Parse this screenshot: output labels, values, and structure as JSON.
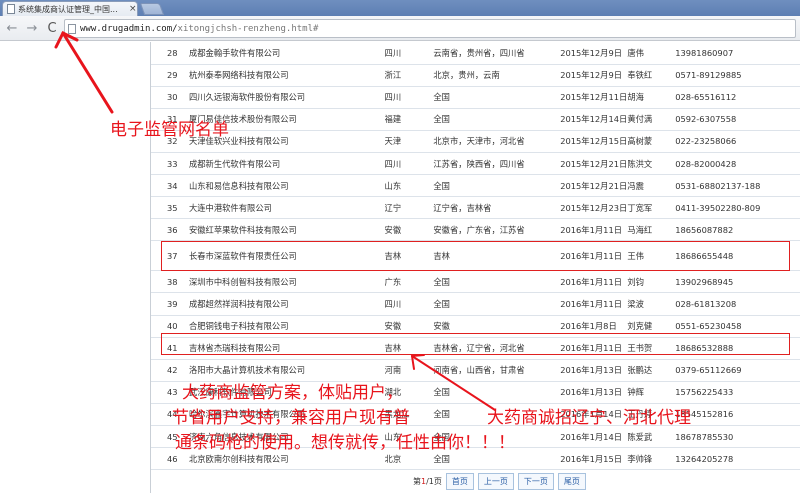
{
  "browser": {
    "tab_title": "系统集成商认证管理_中国...",
    "tab_close": "×",
    "back_glyph": "←",
    "forward_glyph": "→",
    "reload_glyph": "C",
    "url_prefix": "www.drugadmin.com/",
    "url_path": "xitongjchsh-renzheng.html#"
  },
  "table": {
    "rows": [
      {
        "no": "28",
        "name": "成都金翰手软件有限公司",
        "province": "四川",
        "area": "云南省，贵州省，四川省",
        "date": "2015年12月9日",
        "person": "唐伟",
        "phone": "13981860907"
      },
      {
        "no": "29",
        "name": "杭州泰奉网络科技有限公司",
        "province": "浙江",
        "area": "北京，贵州，云南",
        "date": "2015年12月9日",
        "person": "奉铁红",
        "phone": "0571-89129885"
      },
      {
        "no": "30",
        "name": "四川久远银海软件股份有限公司",
        "province": "四川",
        "area": "全国",
        "date": "2015年12月11日",
        "person": "胡海",
        "phone": "028-65516112"
      },
      {
        "no": "31",
        "name": "厦门易佳信技术股份有限公司",
        "province": "福建",
        "area": "全国",
        "date": "2015年12月14日",
        "person": "黄付满",
        "phone": "0592-6307558"
      },
      {
        "no": "32",
        "name": "天津佳软兴业科技有限公司",
        "province": "天津",
        "area": "北京市，天津市，河北省",
        "date": "2015年12月15日",
        "person": "高树蒙",
        "phone": "022-23258066"
      },
      {
        "no": "33",
        "name": "成都新生代软件有限公司",
        "province": "四川",
        "area": "江苏省，陕西省，四川省",
        "date": "2015年12月21日",
        "person": "陈洪文",
        "phone": "028-82000428"
      },
      {
        "no": "34",
        "name": "山东和易信息科技有限公司",
        "province": "山东",
        "area": "全国",
        "date": "2015年12月21日",
        "person": "冯震",
        "phone": "0531-68802137-188"
      },
      {
        "no": "35",
        "name": "大连中港软件有限公司",
        "province": "辽宁",
        "area": "辽宁省，吉林省",
        "date": "2015年12月23日",
        "person": "丁宽军",
        "phone": "0411-39502280-809"
      },
      {
        "no": "36",
        "name": "安徽红苹果软件科技有限公司",
        "province": "安徽",
        "area": "安徽省，广东省，江苏省",
        "date": "2016年1月11日",
        "person": "马海红",
        "phone": "18656087882"
      },
      {
        "no": "37",
        "name": "长春市深蓝软件有限责任公司",
        "province": "吉林",
        "area": "吉林",
        "date": "2016年1月11日",
        "person": "王伟",
        "phone": "18686655448"
      },
      {
        "no": "38",
        "name": "深圳市中科创智科技有限公司",
        "province": "广东",
        "area": "全国",
        "date": "2016年1月11日",
        "person": "刘钧",
        "phone": "13902968945"
      },
      {
        "no": "39",
        "name": "成都超然祥润科技有限公司",
        "province": "四川",
        "area": "全国",
        "date": "2016年1月11日",
        "person": "梁波",
        "phone": "028-61813208"
      },
      {
        "no": "40",
        "name": "合肥铜钱电子科技有限公司",
        "province": "安徽",
        "area": "安徽",
        "date": "2016年1月8日",
        "person": "刘克健",
        "phone": "0551-65230458"
      },
      {
        "no": "41",
        "name": "吉林省杰瑞科技有限公司",
        "province": "吉林",
        "area": "吉林省，辽宁省，河北省",
        "date": "2016年1月11日",
        "person": "王书贺",
        "phone": "18686532888"
      },
      {
        "no": "42",
        "name": "洛阳市大晶计算机技术有限公司",
        "province": "河南",
        "area": "河南省，山西省，甘肃省",
        "date": "2016年1月13日",
        "person": "张鹏达",
        "phone": "0379-65112669"
      },
      {
        "no": "43",
        "name": "武汉康科软件有限公司",
        "province": "湖北",
        "area": "全国",
        "date": "2016年1月13日",
        "person": "钟辉",
        "phone": "15756225433"
      },
      {
        "no": "44",
        "name": "哈尔滨鑫字计算机技术有限公司",
        "province": "黑龙江",
        "area": "全国",
        "date": "2016年1月14日",
        "person": "王丹婷",
        "phone": "18545152816"
      },
      {
        "no": "45",
        "name": "济南六角信息技术有限公司",
        "province": "山东",
        "area": "全国",
        "date": "2016年1月14日",
        "person": "陈爱武",
        "phone": "18678785530"
      },
      {
        "no": "46",
        "name": "北京欧南尔创科技有限公司",
        "province": "北京",
        "area": "全国",
        "date": "2016年1月15日",
        "person": "李帅锋",
        "phone": "13264205278"
      }
    ]
  },
  "pager": {
    "prefix": "第",
    "current": "1",
    "middle": "/1",
    "suffix": "页",
    "first": "首页",
    "prev": "上一页",
    "next": "下一页",
    "last": "尾页"
  },
  "annotations": {
    "label_top": "电子监管网名单",
    "line1": "大药商监管方案，体贴用户，",
    "line2": "节省用户支持，兼容用户现有普",
    "line2b": "大药商诚招辽宁、河北代理",
    "line3": "通条码枪的使用。想传就传，任性由你！！！",
    "color": "#e8141c"
  }
}
